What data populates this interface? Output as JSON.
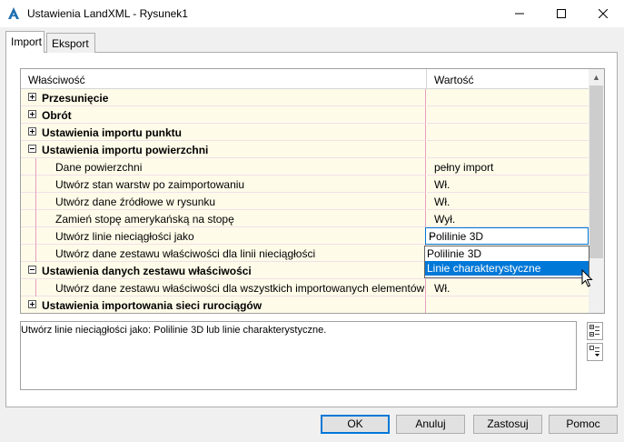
{
  "window": {
    "title": "Ustawienia LandXML - Rysunek1",
    "app_icon": "autocad-civil-a-icon"
  },
  "tabs": [
    {
      "label": "Import",
      "active": true
    },
    {
      "label": "Eksport",
      "active": false
    }
  ],
  "grid": {
    "col_property": "Właściwość",
    "col_value": "Wartość",
    "rows": [
      {
        "label": "Przesunięcie",
        "value": "",
        "level": 0,
        "expanded": false
      },
      {
        "label": "Obrót",
        "value": "",
        "level": 0,
        "expanded": false
      },
      {
        "label": "Ustawienia importu punktu",
        "value": "",
        "level": 0,
        "expanded": false
      },
      {
        "label": "Ustawienia importu powierzchni",
        "value": "",
        "level": 0,
        "expanded": true
      },
      {
        "label": "Dane powierzchni",
        "value": "pełny import",
        "level": 1
      },
      {
        "label": "Utwórz stan warstw po zaimportowaniu",
        "value": "Wł.",
        "level": 1
      },
      {
        "label": "Utwórz dane źródłowe w rysunku",
        "value": "Wł.",
        "level": 1
      },
      {
        "label": "Zamień stopę amerykańską na stopę",
        "value": "Wył.",
        "level": 1
      },
      {
        "label": "Utwórz linie nieciągłości jako",
        "value": "Polilinie 3D",
        "level": 1,
        "selected": true
      },
      {
        "label": "Utwórz dane zestawu właściwości dla linii nieciągłości",
        "value": "",
        "level": 1
      },
      {
        "label": "Ustawienia danych zestawu właściwości",
        "value": "",
        "level": 0,
        "expanded": true
      },
      {
        "label": "Utwórz dane zestawu właściwości dla wszystkich importowanych elementów",
        "value": "Wł.",
        "level": 1
      },
      {
        "label": "Ustawienia importowania sieci rurociągów",
        "value": "",
        "level": 0,
        "expanded": false
      }
    ]
  },
  "dropdown": {
    "options": [
      "Polilinie 3D",
      "Linie charakterystyczne"
    ],
    "highlighted": 1
  },
  "description": "Utwórz linie nieciągłości jako: Polilinie 3D lub linie charakterystyczne.",
  "buttons": {
    "ok": "OK",
    "cancel": "Anuluj",
    "apply": "Zastosuj",
    "help": "Pomoc"
  },
  "colors": {
    "accent": "#0078d7",
    "row_bg": "#fffbe9",
    "grid_line": "#e4a0c0"
  }
}
